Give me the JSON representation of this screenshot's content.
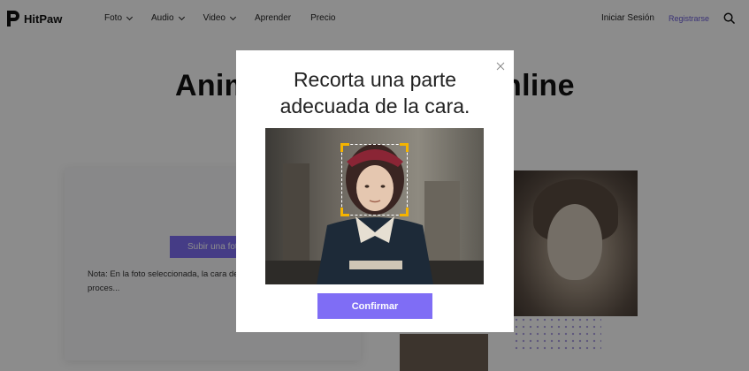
{
  "brand": {
    "name": "HitPaw"
  },
  "nav": {
    "items": [
      {
        "label": "Foto",
        "dropdown": true
      },
      {
        "label": "Audio",
        "dropdown": true
      },
      {
        "label": "Video",
        "dropdown": true
      },
      {
        "label": "Aprender",
        "dropdown": false
      },
      {
        "label": "Precio",
        "dropdown": false
      }
    ],
    "login": "Iniciar Sesión",
    "register": "Registrarse"
  },
  "hero": {
    "title_left": "Anim",
    "title_right": "nline"
  },
  "upload": {
    "button": "Subir una foto",
    "note": "Nota: En la foto seleccionada, la cara debe ... contrario, no se puede proces..."
  },
  "modal": {
    "title_line1": "Recorta una parte",
    "title_line2": "adecuada de la cara.",
    "close": "X",
    "confirm": "Confirmar"
  },
  "colors": {
    "accent": "#7f6df5",
    "crop_handle": "#f5b400",
    "link": "#6a5bd8"
  }
}
